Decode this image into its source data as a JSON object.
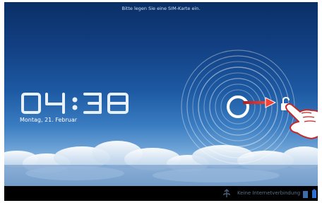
{
  "status_bar": {
    "sim_message": "Bitte legen Sie eine SIM-Karte ein."
  },
  "lock_screen": {
    "time": "04:38",
    "date": "Montag, 21. Februar"
  },
  "system_bar": {
    "network_status": "Keine Internetverbindung"
  },
  "icons": {
    "unlock": "unlock-icon",
    "hand": "hand-pointer-icon",
    "arrow": "arrow-right-icon",
    "usb": "usb-icon",
    "battery": "battery-icon",
    "signal": "signal-icon"
  },
  "colors": {
    "accent": "#e53935",
    "status_bar": "#000000"
  }
}
